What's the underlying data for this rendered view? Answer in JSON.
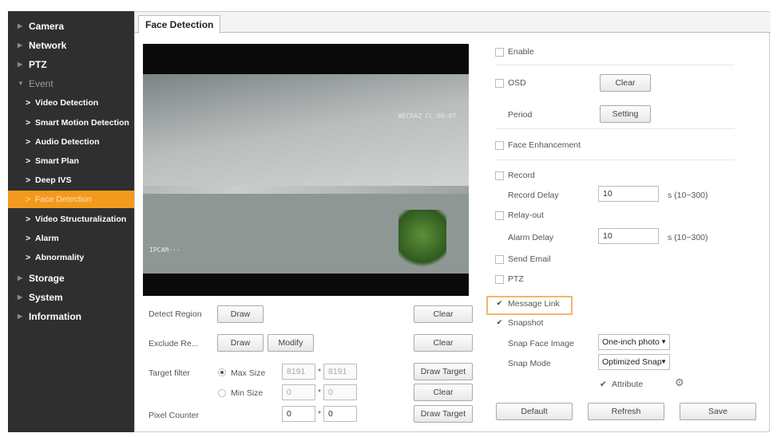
{
  "sidebar": {
    "items": [
      {
        "label": "Camera"
      },
      {
        "label": "Network"
      },
      {
        "label": "PTZ"
      },
      {
        "label": "Event"
      },
      {
        "label": "Storage"
      },
      {
        "label": "System"
      },
      {
        "label": "Information"
      }
    ],
    "event_sub": [
      {
        "label": "Video Detection"
      },
      {
        "label": "Smart Motion Detection"
      },
      {
        "label": "Audio Detection"
      },
      {
        "label": "Smart Plan"
      },
      {
        "label": "Deep IVS"
      },
      {
        "label": "Face Detection"
      },
      {
        "label": "Video Structuralization"
      },
      {
        "label": "Alarm"
      },
      {
        "label": "Abnormality"
      }
    ],
    "active_sub": "Face Detection"
  },
  "tab": {
    "label": "Face Detection"
  },
  "video": {
    "osd_top": "WECRAZ CL:00:07",
    "osd_bottom": "IP­­CAM···"
  },
  "left_controls": {
    "detect_region_label": "Detect Region",
    "exclude_region_label": "Exclude Re...",
    "target_filter_label": "Target filter",
    "pixel_counter_label": "Pixel Counter",
    "draw_label": "Draw",
    "modify_label": "Modify",
    "clear_label": "Clear",
    "draw_target_label": "Draw Target",
    "max_size_label": "Max Size",
    "min_size_label": "Min Size",
    "max_w": "8191",
    "max_h": "8191",
    "min_w": "0",
    "min_h": "0",
    "pixel_w": "0",
    "pixel_h": "0",
    "times": "*"
  },
  "right_controls": {
    "enable": "Enable",
    "osd": "OSD",
    "osd_clear": "Clear",
    "period": "Period",
    "setting": "Setting",
    "face_enhancement": "Face Enhancement",
    "record": "Record",
    "record_delay": "Record Delay",
    "record_delay_value": "10",
    "record_delay_unit": "s (10~300)",
    "relay_out": "Relay-out",
    "alarm_delay": "Alarm Delay",
    "alarm_delay_value": "10",
    "alarm_delay_unit": "s (10~300)",
    "send_email": "Send Email",
    "ptz": "PTZ",
    "message_link": "Message Link",
    "snapshot": "Snapshot",
    "snap_face_image": "Snap Face Image",
    "snap_face_value": "One-inch photo",
    "snap_mode": "Snap Mode",
    "snap_mode_value": "Optimized Snap",
    "attribute": "Attribute",
    "check_mark": "✔"
  },
  "footer": {
    "default": "Default",
    "refresh": "Refresh",
    "save": "Save"
  }
}
